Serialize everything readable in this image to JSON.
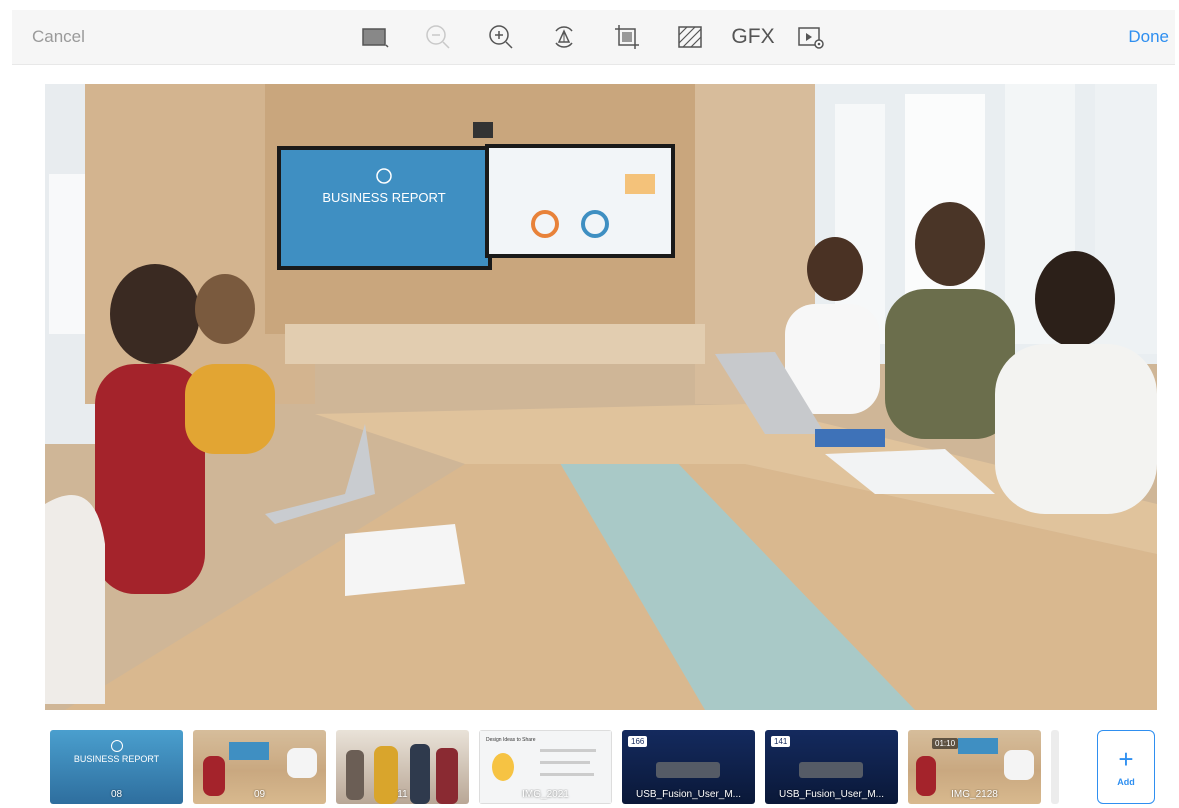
{
  "toolbar": {
    "cancel_label": "Cancel",
    "done_label": "Done",
    "tools": [
      {
        "icon": "aspect-ratio-icon"
      },
      {
        "icon": "zoom-out-icon",
        "disabled": true
      },
      {
        "icon": "zoom-in-icon"
      },
      {
        "icon": "rotate-icon"
      },
      {
        "icon": "crop-icon"
      },
      {
        "icon": "pattern-icon"
      },
      {
        "label": "GFX"
      },
      {
        "icon": "video-settings-icon"
      }
    ]
  },
  "main_image": {
    "screen_title": "BUSINESS REPORT"
  },
  "filmstrip": {
    "items": [
      {
        "caption": "08",
        "title": "BUSINESS REPORT"
      },
      {
        "caption": "09"
      },
      {
        "caption": "11"
      },
      {
        "caption": "IMG_2021",
        "slide_title": "Design Ideas to Share"
      },
      {
        "caption": "USB_Fusion_User_M...",
        "badge": "166"
      },
      {
        "caption": "USB_Fusion_User_M...",
        "badge": "141"
      },
      {
        "caption": "IMG_2128",
        "badge": "01:10"
      }
    ],
    "add_label": "Add"
  },
  "colors": {
    "accent": "#2f8ff0",
    "toolbar_bg": "#f6f6f6"
  }
}
